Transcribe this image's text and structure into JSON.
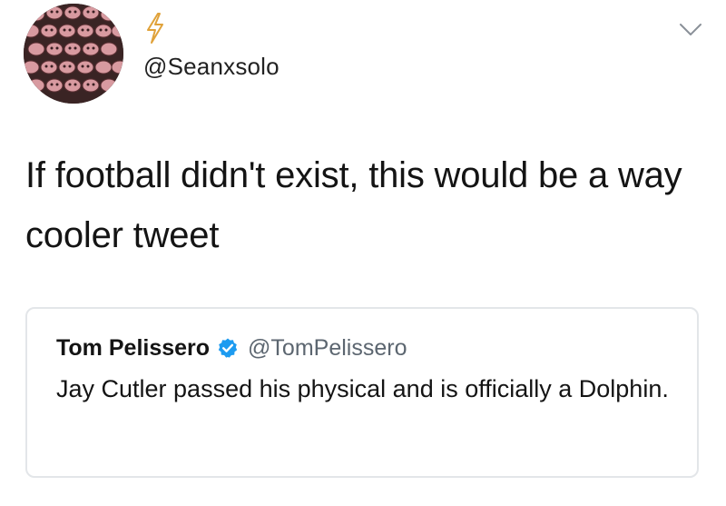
{
  "tweet": {
    "handle": "@Seanxsolo",
    "avatar_icon": "mosaic-face-avatar",
    "name_icon": "lightning-bolt-icon",
    "menu_icon": "chevron-down-icon",
    "text": "If football didn't exist, this would be a way cooler tweet"
  },
  "quoted_tweet": {
    "name": "Tom Pelissero",
    "verified_icon": "verified-badge-icon",
    "handle": "@TomPelissero",
    "text": "Jay Cutler passed his physical and is officially a Dolphin."
  },
  "colors": {
    "text": "#141414",
    "muted": "#5c6670",
    "verified_blue": "#1d9bf0",
    "bolt": "#e0a23a",
    "card_border": "#e3e6e9"
  }
}
